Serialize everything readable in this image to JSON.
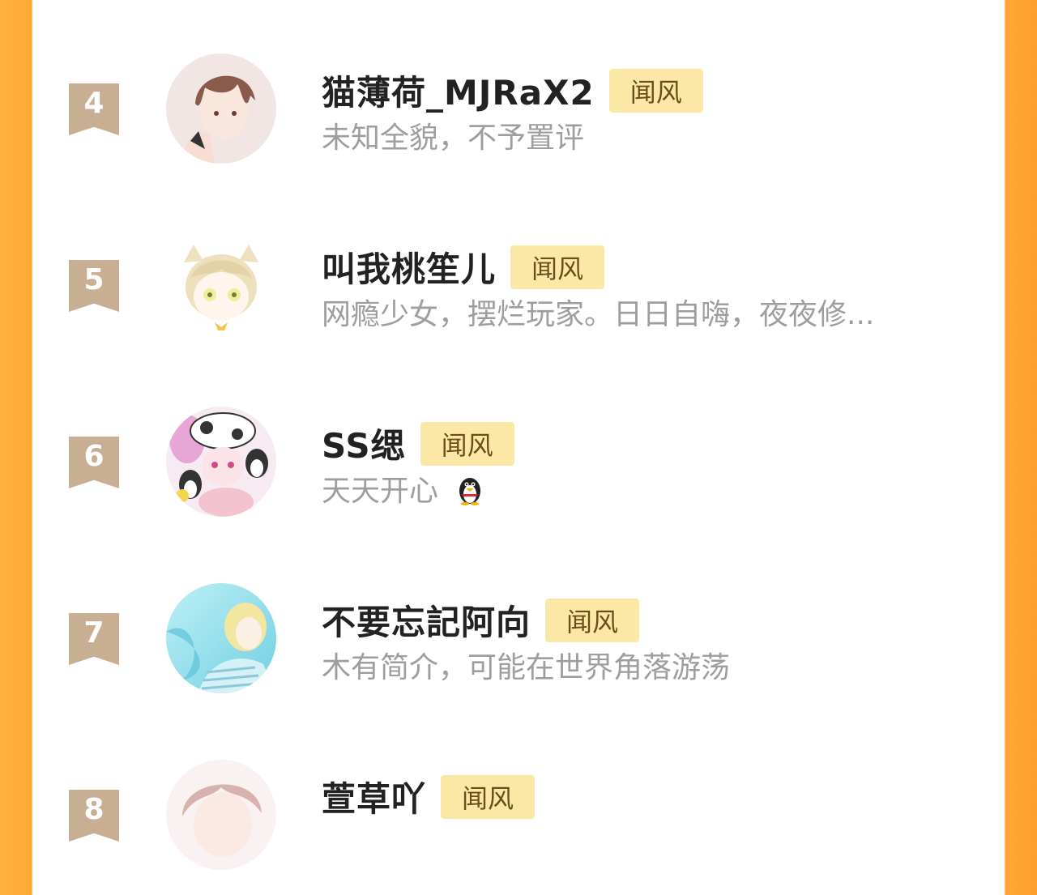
{
  "list": {
    "items": [
      {
        "rank": "4",
        "name": "猫薄荷_MJRaX2",
        "tag": "闻风",
        "bio": "未知全貌，不予置评",
        "avatar_icon": "avatar-brown-hair-headphones",
        "avatar_colors": [
          "#eed7d0",
          "#8a5a4a"
        ]
      },
      {
        "rank": "5",
        "name": "叫我桃笙儿",
        "tag": "闻风",
        "bio": "网瘾少女，摆烂玩家。日日自嗨，夜夜修...",
        "avatar_icon": "avatar-blonde-cat-ears",
        "avatar_colors": [
          "#fff8ee",
          "#e9d7b0"
        ]
      },
      {
        "rank": "6",
        "name": "SS缌",
        "tag": "闻风",
        "bio": "天天开心",
        "bio_icon": "penguin-icon",
        "avatar_icon": "avatar-pink-cow-penguins",
        "avatar_colors": [
          "#f7d3e6",
          "#333333"
        ]
      },
      {
        "rank": "7",
        "name": "不要忘記阿向",
        "tag": "闻风",
        "bio": "木有简介，可能在世界角落游荡",
        "avatar_icon": "avatar-blue-water-blonde",
        "avatar_colors": [
          "#8fdcec",
          "#f2e08a"
        ]
      },
      {
        "rank": "8",
        "name": "萱草吖",
        "tag": "闻风",
        "bio": "",
        "avatar_icon": "avatar-pink-hair",
        "avatar_colors": [
          "#f3dede",
          "#b98d8a"
        ]
      }
    ]
  },
  "colors": {
    "accent": "#ffa934",
    "tag_bg": "#fbe8a6",
    "rank_bg": "#c8ae92"
  }
}
